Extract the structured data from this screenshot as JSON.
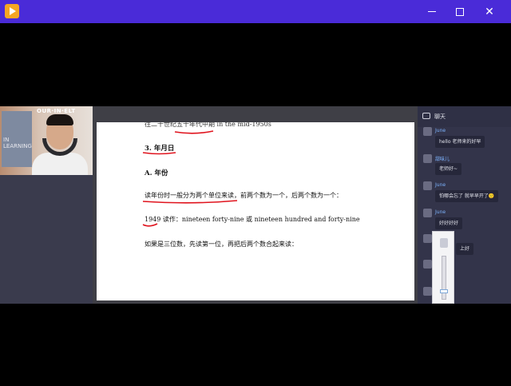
{
  "window": {
    "minimize": "—",
    "maximize": "☐",
    "close": "✕"
  },
  "webcam": {
    "brand": "OUR·IN·ELT",
    "poster_text": "IN\nLEARNING"
  },
  "slide": {
    "top_line": "往二十世纪五十年代中期 in the mid-1950s",
    "heading_3": "3. 年月日",
    "heading_a": "A. 年份",
    "para_1": "读年份时一般分为两个单位来读，前两个数为一个，后两个数为一个：",
    "para_2": "1949  读作：nineteen forty-nine 或 nineteen hundred and forty-nine",
    "para_3": "如果是三位数，先读第一位，再把后两个数合起来读："
  },
  "chat": {
    "title": "聊天",
    "messages": [
      {
        "user": "June",
        "text": "hello 老师来的好早"
      },
      {
        "user": "甜味儿",
        "text": "老师好~"
      },
      {
        "user": "June",
        "text": "怕哪会忘了 就早早开了🙂"
      },
      {
        "user": "June",
        "text": "好好好好"
      },
      {
        "user": "",
        "text": "上好"
      }
    ]
  }
}
